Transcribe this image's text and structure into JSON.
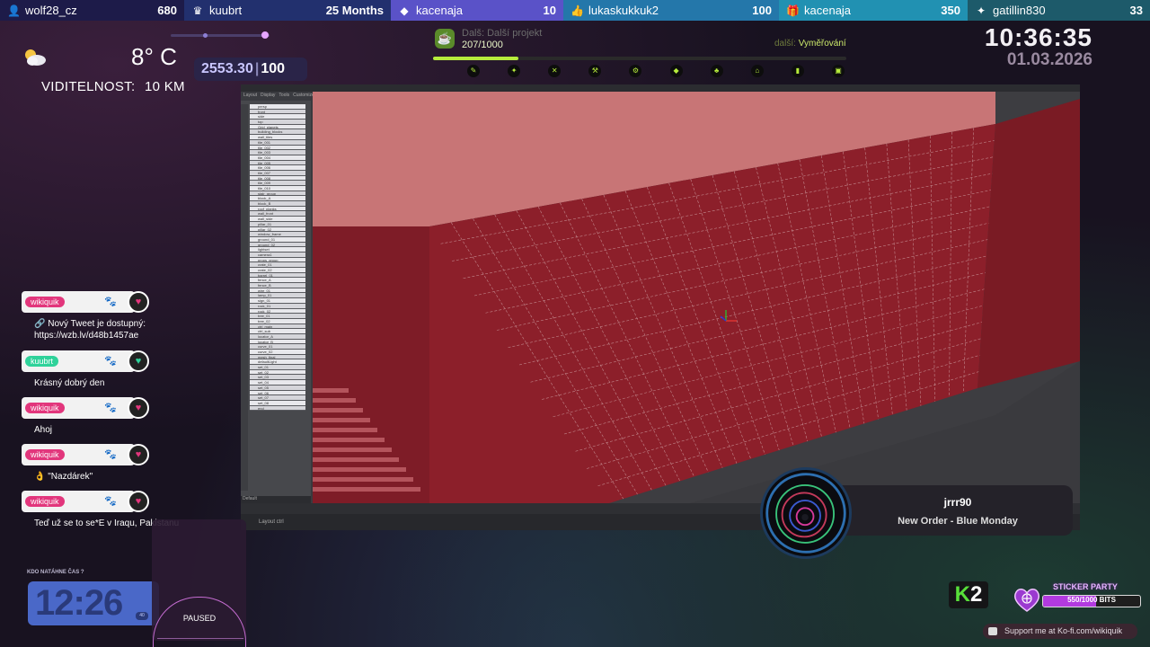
{
  "topbar": [
    {
      "icon": "person-add-icon",
      "name": "wolf28_cz",
      "value": "680",
      "bg": "#1d1b49"
    },
    {
      "icon": "crown-icon",
      "name": "kuubrt",
      "value": "25 Months",
      "bg": "#22306e"
    },
    {
      "icon": "diamond-icon",
      "name": "kacenaja",
      "value": "10",
      "bg": "#5a52c8"
    },
    {
      "icon": "thumbs-up-icon",
      "name": "lukaskukkuk2",
      "value": "100",
      "bg": "#2477aa"
    },
    {
      "icon": "gift-icon",
      "name": "kacenaja",
      "value": "350",
      "bg": "#2191b2"
    },
    {
      "icon": "star-icon",
      "name": "gatillin830",
      "value": "33",
      "bg": "#1d5a6a"
    }
  ],
  "weather": {
    "icon": "partly-cloudy-icon",
    "temperature": "8° C",
    "visibility_label": "VIDITELNOST:",
    "visibility_value": "10 KM"
  },
  "counter": {
    "current": "2553.30",
    "separator": "|",
    "target": "100",
    "slider_level": 0.95
  },
  "project": {
    "title": "Dalš: Další projekt",
    "count": "207/1000",
    "next_label": "další:",
    "next_value": "Vyměřování",
    "progress": 0.207
  },
  "clock": {
    "time": "10:36:35",
    "date": "01.03.2026"
  },
  "chat": [
    {
      "user": "wikiquik",
      "tag_color": "#e2367c",
      "paw": "🐾",
      "text_lines": [
        "🔗 Nový Tweet je dostupný:",
        "https://wzb.lv/d48b1457ae"
      ]
    },
    {
      "user": "kuubrt",
      "tag_color": "#2fd29a",
      "paw": "🐾",
      "text_lines": [
        "Krásný dobrý den"
      ]
    },
    {
      "user": "wikiquik",
      "tag_color": "#e2367c",
      "paw": "🐾",
      "text_lines": [
        "Ahoj"
      ]
    },
    {
      "user": "wikiquik",
      "tag_color": "#e2367c",
      "paw": "🐾",
      "text_lines": [
        "👌 \"Nazdárek\""
      ]
    },
    {
      "user": "wikiquik",
      "tag_color": "#e2367c",
      "paw": "🐾",
      "text_lines": [
        "Teď už se to se*E v Iraqu, Pakistanu"
      ]
    }
  ],
  "timer_widget": {
    "label": "KDO NATÁHNE ČAS ?",
    "time": "12:26",
    "badge": "40"
  },
  "paused_widget": {
    "label": "PAUSED"
  },
  "now_playing": {
    "user": "jrrr90",
    "song": "New Order - Blue Monday"
  },
  "k2": {
    "k": "K",
    "two": "2"
  },
  "sticker_party": {
    "title": "STICKER PARTY",
    "progress_text": "550/1000 BITS",
    "progress": 0.55
  },
  "kofi": {
    "text": "Support me at Ko-fi.com/wikiquik"
  },
  "editor": {
    "outliner_header": [
      "Layout",
      "Display",
      "Tools",
      "Customize"
    ],
    "outliner_items": [
      "persp",
      "front",
      "side",
      "top",
      "Grid_planets",
      "building_blocks",
      "wall_tiles",
      "tile_001",
      "tile_002",
      "tile_003",
      "tile_004",
      "tile_005",
      "tile_006",
      "tile_007",
      "tile_008",
      "tile_009",
      "tile_010",
      "stair_group",
      "block_A",
      "block_B",
      "roof_planks",
      "wall_front",
      "wall_side",
      "pillar_01",
      "pillar_02",
      "window_frame",
      "ground_01",
      "ground_02",
      "lightset",
      "camera1",
      "props_group",
      "crate_01",
      "crate_02",
      "barrel_01",
      "fence_A",
      "fence_B",
      "wire_01",
      "lamp_01",
      "sign_01",
      "rock_01",
      "rock_02",
      "tree_01",
      "tree_02",
      "ctrl_main",
      "ctrl_sub",
      "locator_A",
      "locator_B",
      "curve_01",
      "curve_02",
      "mesh_final",
      "defaultLight",
      "set_01",
      "set_02",
      "set_03",
      "set_04",
      "set_05",
      "set_06",
      "set_07",
      "set_08",
      "end"
    ],
    "bottom_label": "Default",
    "status_text": "Layout ctrl"
  }
}
